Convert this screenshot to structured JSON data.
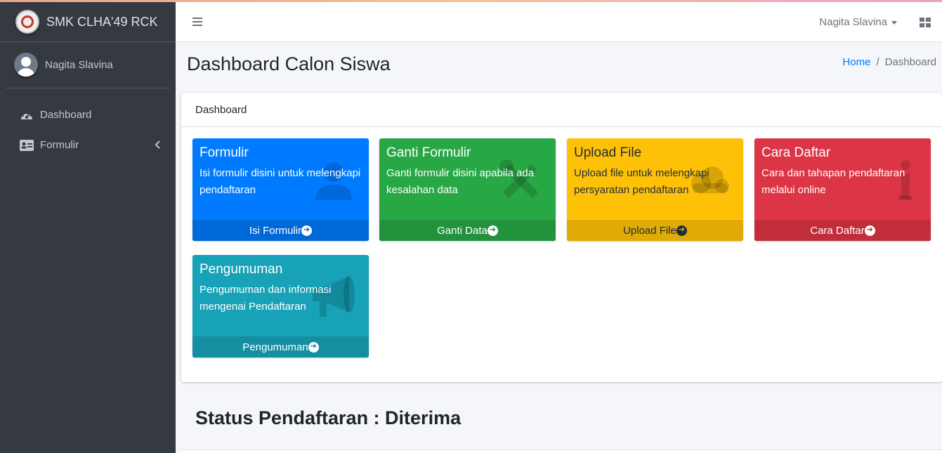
{
  "brand": {
    "name": "SMK CLHA'49 RCK"
  },
  "sidebar": {
    "user_name": "Nagita Slavina",
    "items": [
      {
        "label": "Dashboard",
        "icon": "tachometer-icon"
      },
      {
        "label": "Formulir",
        "icon": "id-card-icon"
      }
    ]
  },
  "navbar": {
    "user_name": "Nagita Slavina"
  },
  "header": {
    "title": "Dashboard Calon Siswa",
    "breadcrumb": {
      "home": "Home",
      "current": "Dashboard"
    }
  },
  "card": {
    "title": "Dashboard",
    "boxes": [
      {
        "title": "Formulir",
        "desc": "Isi formulir disini untuk melengkapi pendaftaran",
        "footer": "Isi Formulir",
        "icon": "user-icon",
        "color": "#007bff"
      },
      {
        "title": "Ganti Formulir",
        "desc": "Ganti formulir disini apabila ada kesalahan data",
        "footer": "Ganti Data",
        "icon": "tools-icon",
        "color": "#28a745"
      },
      {
        "title": "Upload File",
        "desc": "Upload file untuk melengkapi persyaratan pendaftaran",
        "footer": "Upload File",
        "icon": "cloud-upload-icon",
        "color": "#ffc107"
      },
      {
        "title": "Cara Daftar",
        "desc": "Cara dan tahapan pendaftaran melalui online",
        "footer": "Cara Daftar",
        "icon": "info-icon",
        "color": "#dc3545"
      },
      {
        "title": "Pengumuman",
        "desc": "Pengumuman dan informasi mengenai Pendaftaran",
        "footer": "Pengumuman",
        "icon": "bullhorn-icon",
        "color": "#17a2b8"
      }
    ]
  },
  "status": {
    "text": "Status Pendaftaran : Diterima"
  }
}
